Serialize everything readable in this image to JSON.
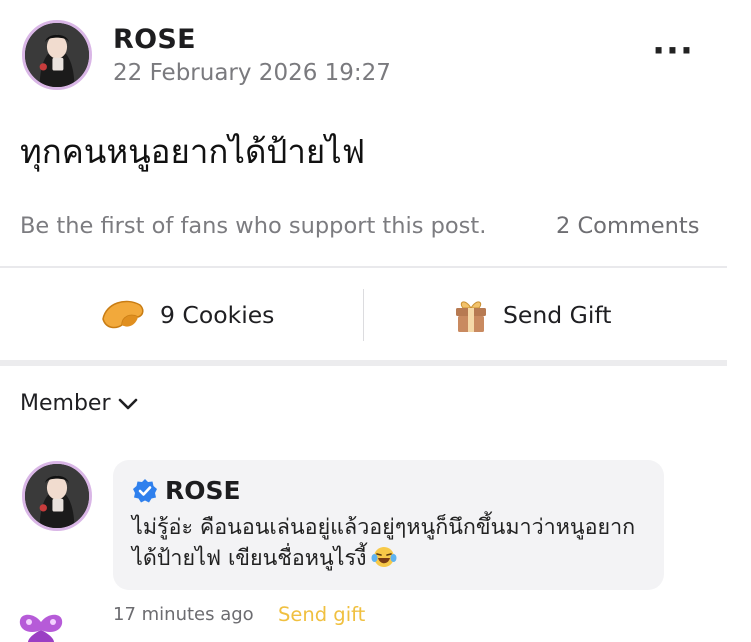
{
  "post": {
    "author": "ROSE",
    "timestamp": "22 February 2026 19:27",
    "more_icon": "more-dots-icon",
    "text": "ทุกคนหนูอยากได้ป้ายไฟ",
    "support_text": "Be the first of fans who support this post.",
    "comments_count": "2 Comments"
  },
  "actions": {
    "cookies_label": "9 Cookies",
    "cookies_icon": "fortune-cookie-icon",
    "gift_label": "Send Gift",
    "gift_icon": "gift-box-icon"
  },
  "filter": {
    "label": "Member",
    "icon": "chevron-down-icon"
  },
  "comment": {
    "author": "ROSE",
    "verified_icon": "verified-badge-icon",
    "text": "ไม่รู้อ่ะ คือนอนเล่นอยู่แล้วอยู่ๆหนูก็นึกขึ้นมาว่าหนูอยากได้ป้ายไฟ เขียนชื่อหนูไรงี้",
    "emoji": "laughing-tears-emoji",
    "time": "17 minutes ago",
    "send_gift": "Send gift"
  },
  "colors": {
    "avatar_ring": "#d9b6e6",
    "verified_blue": "#2f80ed",
    "gift_link": "#f0c040",
    "bubble_bg": "#f3f3f5",
    "divider": "#e9e9ec"
  }
}
